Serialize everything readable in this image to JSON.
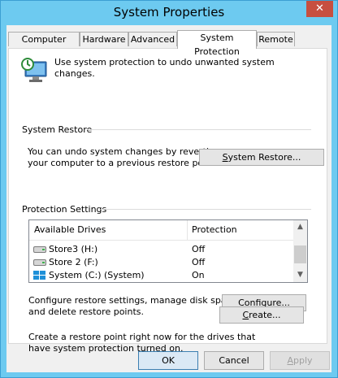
{
  "window": {
    "title": "System Properties",
    "close_label": "✕"
  },
  "tabs": [
    {
      "label": "Computer Name"
    },
    {
      "label": "Hardware"
    },
    {
      "label": "Advanced"
    },
    {
      "label": "System Protection"
    },
    {
      "label": "Remote"
    }
  ],
  "intro": {
    "text": "Use system protection to undo unwanted system changes."
  },
  "system_restore": {
    "group_label": "System Restore",
    "description_line1": "You can undo system changes by reverting",
    "description_line2": "your computer to a previous restore point.",
    "button_prefix": "",
    "button_accel": "S",
    "button_suffix": "ystem Restore..."
  },
  "protection": {
    "group_label": "Protection Settings",
    "columns": {
      "drives": "Available Drives",
      "protection": "Protection"
    },
    "drives": [
      {
        "name": "Store3 (H:)",
        "protection": "Off"
      },
      {
        "name": "Store 2 (F:)",
        "protection": "Off"
      },
      {
        "name": "System (C:) (System)",
        "protection": "On"
      }
    ],
    "configure_line1": "Configure restore settings, manage disk space,",
    "configure_line2": "and delete restore points.",
    "configure_prefix": "C",
    "configure_accel": "o",
    "configure_suffix": "nfigure...",
    "create_line1": "Create a restore point right now for the drives that",
    "create_line2": "have system protection turned on.",
    "create_prefix": "",
    "create_accel": "C",
    "create_suffix": "reate..."
  },
  "footer": {
    "ok": "OK",
    "cancel": "Cancel",
    "apply_prefix": "",
    "apply_accel": "A",
    "apply_suffix": "pply"
  }
}
